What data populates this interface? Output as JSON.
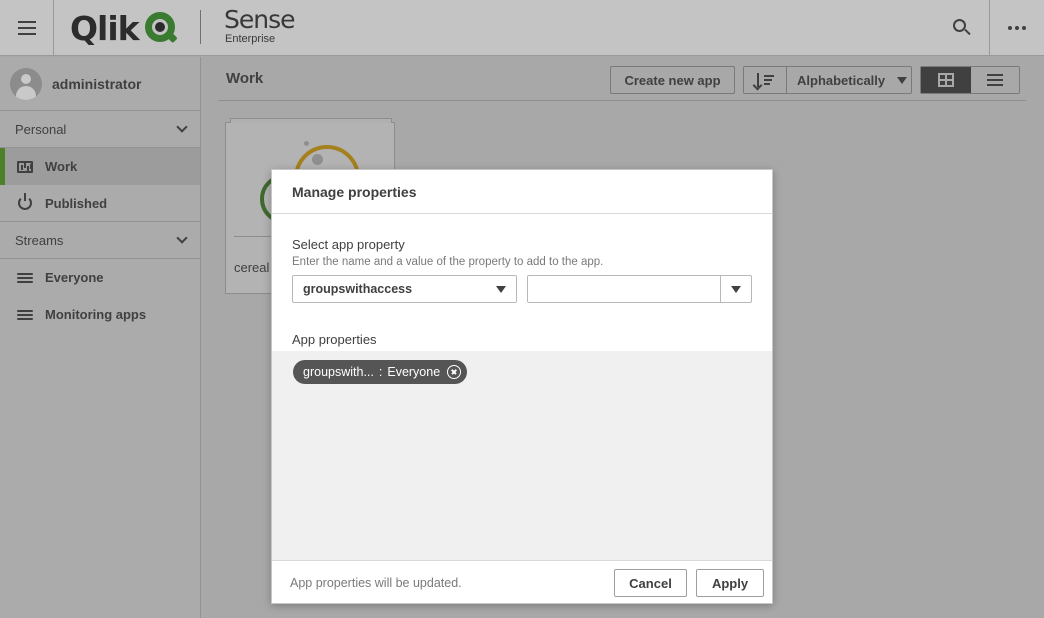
{
  "app": {
    "logo_text": "Qlik",
    "product_name": "Sense",
    "product_edition": "Enterprise"
  },
  "icons": {
    "menu": "hamburger-icon",
    "search": "search-icon",
    "more": "more-icon",
    "work": "chart-icon",
    "published": "power-icon",
    "stream": "stream-icon"
  },
  "sidebar": {
    "user_name": "administrator",
    "personal_label": "Personal",
    "work_label": "Work",
    "published_label": "Published",
    "streams_label": "Streams",
    "streams": [
      {
        "label": "Everyone"
      },
      {
        "label": "Monitoring apps"
      }
    ]
  },
  "main": {
    "title": "Work",
    "create_label": "Create new app",
    "sort_label": "Alphabetically",
    "apps": [
      {
        "name": "cereal"
      }
    ]
  },
  "modal": {
    "title": "Manage properties",
    "select_label": "Select app property",
    "select_hint": "Enter the name and a value of the property to add to the app.",
    "property_value": "groupswithaccess",
    "value_input": "",
    "props_label": "App properties",
    "chip": {
      "name": "groupswith...",
      "separator": ":",
      "value": "Everyone"
    },
    "footer_msg": "App properties will be updated.",
    "cancel_label": "Cancel",
    "apply_label": "Apply"
  },
  "colors": {
    "accent_green": "#4e7f2b",
    "chip_bg": "#555555"
  }
}
